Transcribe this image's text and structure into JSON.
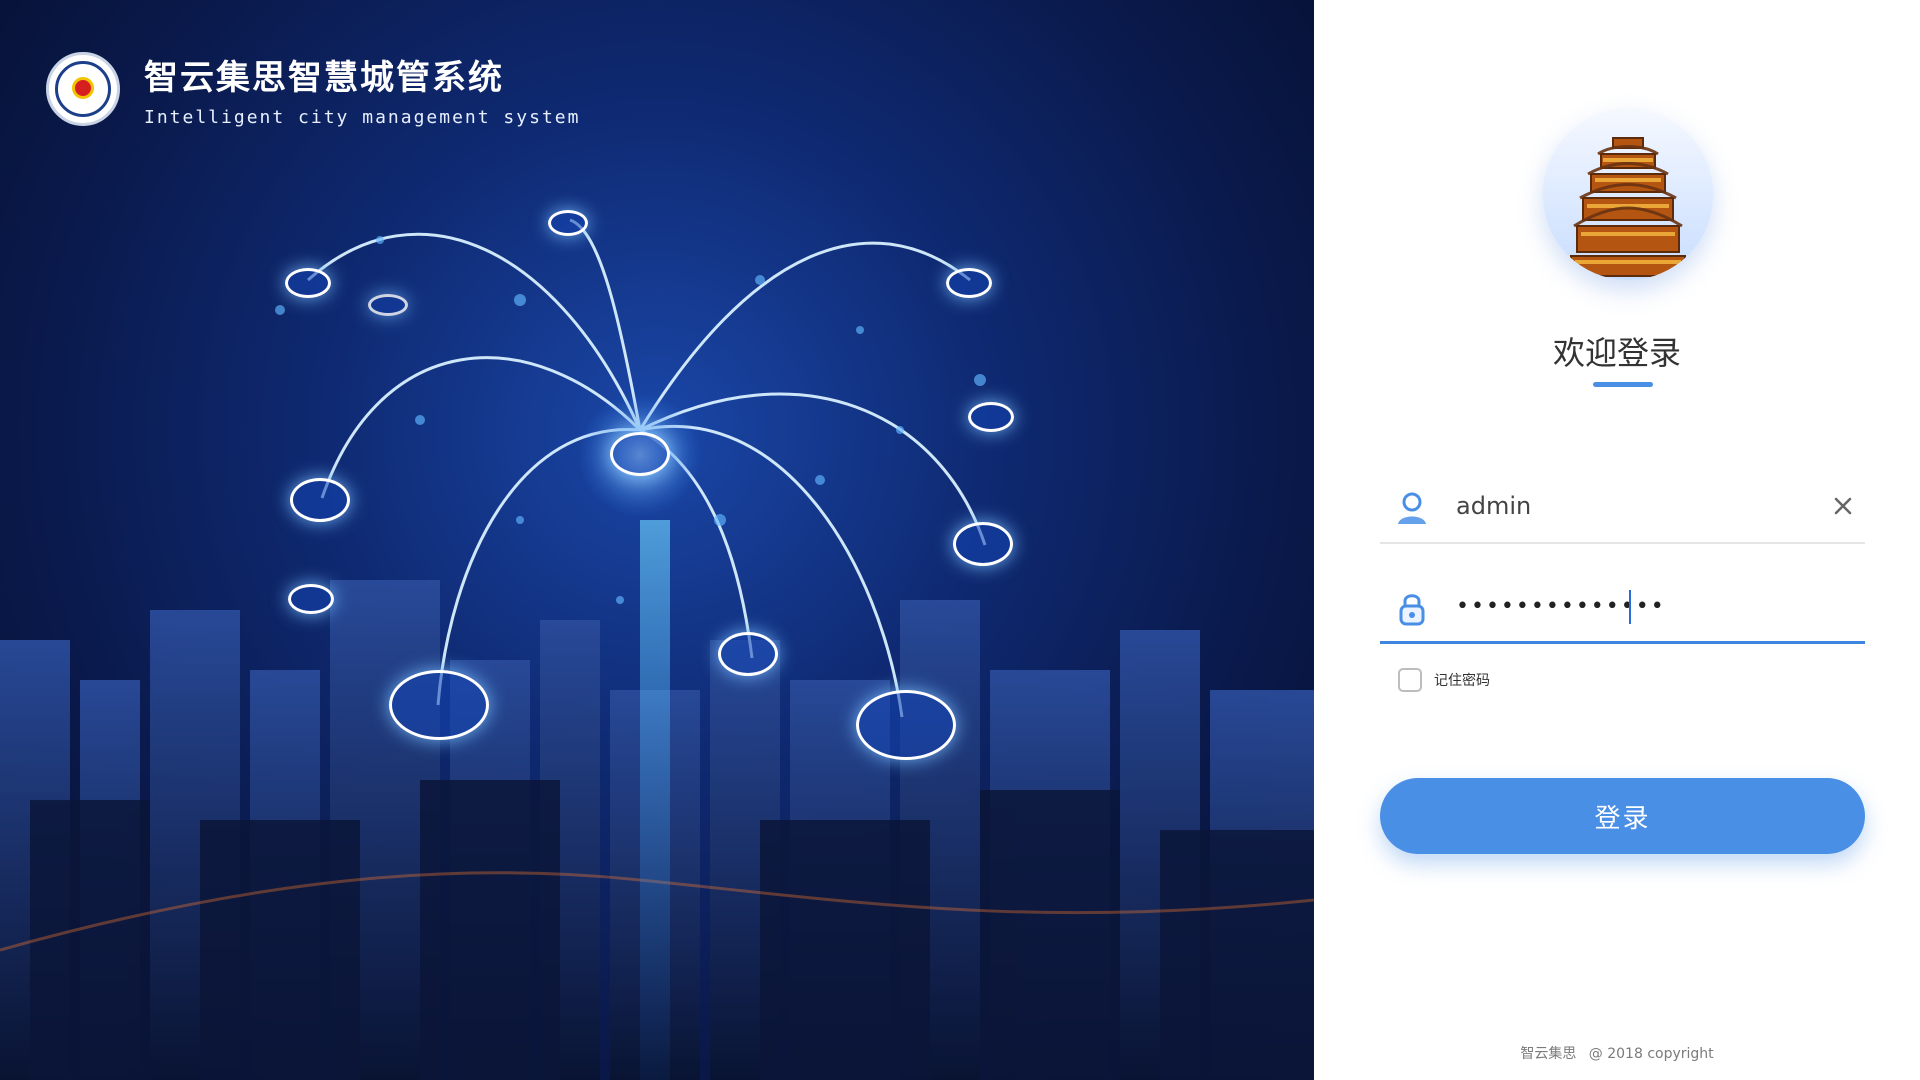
{
  "brand": {
    "title": "智云集思智慧城管系统",
    "subtitle": "Intelligent city management system"
  },
  "login": {
    "welcome": "欢迎登录",
    "username_value": "admin",
    "password_value": "••••••••••••••",
    "remember_label": "记住密码",
    "button_label": "登录"
  },
  "footer": {
    "company": "智云集思",
    "copyright": "@ 2018 copyright"
  },
  "colors": {
    "accent": "#4a8fe6",
    "hero_dark": "#0a1a4d"
  },
  "icons": {
    "user": "user-icon",
    "lock": "lock-icon",
    "clear": "close-icon"
  }
}
